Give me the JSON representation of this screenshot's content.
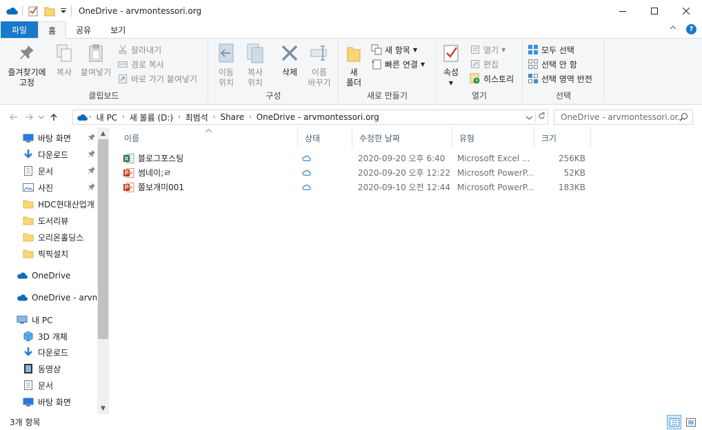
{
  "window": {
    "title": "OneDrive - arvmontessori.org",
    "minimize": "—",
    "maximize": "☐",
    "close": "✕"
  },
  "ribbon_tabs": [
    "파일",
    "홈",
    "공유",
    "보기"
  ],
  "ribbon": {
    "clipboard": {
      "label": "클립보드",
      "pin": "즐겨찾기에\n고정",
      "copy": "복사",
      "paste": "붙여넣기",
      "cut": "잘라내기",
      "copy_path": "경로 복사",
      "paste_shortcut": "바로 가기 붙여넣기"
    },
    "organize": {
      "label": "구성",
      "move_to": "이동\n위치",
      "copy_to": "복사\n위치",
      "delete": "삭제",
      "rename": "이름\n바꾸기"
    },
    "new": {
      "label": "새로 만들기",
      "new_folder": "새\n폴더",
      "new_item": "새 항목",
      "easy_access": "빠른 연결"
    },
    "open": {
      "label": "열기",
      "properties": "속성",
      "open": "열기",
      "edit": "편집",
      "history": "히스토리"
    },
    "select": {
      "label": "선택",
      "select_all": "모두 선택",
      "select_none": "선택 안 함",
      "invert": "선택 영역 반전"
    }
  },
  "address": {
    "crumbs": [
      "내 PC",
      "새 볼륨 (D:)",
      "최범석",
      "Share",
      "OneDrive - arvmontessori.org"
    ],
    "search_placeholder": "OneDrive - arvmontessori.or..."
  },
  "nav_pane": {
    "quick_access": [
      {
        "label": "바탕 화면",
        "icon": "desktop-icon",
        "pinned": true
      },
      {
        "label": "다운로드",
        "icon": "download-icon",
        "pinned": true
      },
      {
        "label": "문서",
        "icon": "document-icon",
        "pinned": true
      },
      {
        "label": "사진",
        "icon": "pictures-icon",
        "pinned": true
      },
      {
        "label": "HDC현대산업개",
        "icon": "folder-icon",
        "pinned": false
      },
      {
        "label": "도서리뷰",
        "icon": "folder-icon",
        "pinned": false
      },
      {
        "label": "오리온홀딩스",
        "icon": "folder-icon",
        "pinned": false
      },
      {
        "label": "픽픽설치",
        "icon": "folder-icon",
        "pinned": false
      }
    ],
    "onedrive": "OneDrive",
    "onedrive_org": "OneDrive - arvmo",
    "this_pc": "내 PC",
    "pc_items": [
      {
        "label": "3D 개체",
        "icon": "3d-objects-icon"
      },
      {
        "label": "다운로드",
        "icon": "download-icon"
      },
      {
        "label": "동영상",
        "icon": "video-icon"
      },
      {
        "label": "문서",
        "icon": "document-icon"
      },
      {
        "label": "바탕 화면",
        "icon": "desktop-icon"
      }
    ]
  },
  "columns": {
    "name": "이름",
    "status": "상태",
    "modified": "수정한 날짜",
    "type": "유형",
    "size": "크기"
  },
  "files": [
    {
      "name": "블로그포스팅",
      "icon": "excel-icon",
      "modified": "2020-09-20 오후 6:40",
      "type": "Microsoft Excel ...",
      "size": "256KB"
    },
    {
      "name": "썸네이;ㄹ",
      "icon": "powerpoint-icon",
      "modified": "2020-09-20 오후 12:22",
      "type": "Microsoft PowerP...",
      "size": "52KB"
    },
    {
      "name": "쫄보개미001",
      "icon": "powerpoint-icon",
      "modified": "2020-09-10 오전 12:44",
      "type": "Microsoft PowerP...",
      "size": "183KB"
    }
  ],
  "status_bar": {
    "count": "3개 항목"
  },
  "colors": {
    "file_tab": "#1979ca",
    "ribbon_bg": "#f5f6f7",
    "column_header_text": "#4c607a",
    "onedrive_blue": "#0f6cbd",
    "folder_yellow": "#f8d775"
  }
}
